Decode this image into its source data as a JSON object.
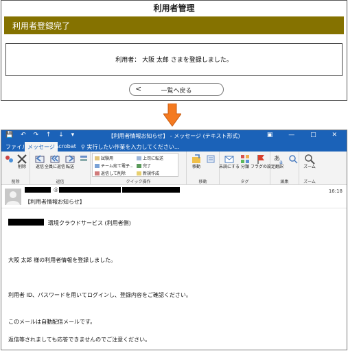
{
  "web": {
    "title": "利用者管理",
    "banner": "利用者登録完了",
    "message": "利用者： 大阪 太郎 さまを登録しました。",
    "back_chevron": "<",
    "back_label": "一覧へ戻る"
  },
  "outlook": {
    "window_title": "【利用者情報お知らせ】 - メッセージ (テキスト形式)",
    "tabs": [
      "ファイル",
      "メッセージ",
      "Acrobat"
    ],
    "tell_me": "実行したい作業を入力してください...",
    "groups": [
      "削除",
      "返信",
      "クイック操作",
      "移動",
      "タグ",
      "編集",
      "ズーム"
    ],
    "buttons": {
      "delete": "削除",
      "reply": "返信",
      "reply_all": "全員に返信",
      "forward": "転送",
      "move": "移動",
      "unread": "未読にする",
      "categorize": "分類",
      "followup": "フラグの設定",
      "translate": "翻訳",
      "zoom": "ズーム"
    },
    "quick_steps": [
      "試験用",
      "チーム宛て電子...",
      "返信して削除",
      "上司に転送",
      "完了",
      "新規作成"
    ],
    "sender_partial": "@",
    "subject": "【利用者情報お知らせ】",
    "time": "16:18",
    "body": [
      "環境クラウドサービス (利用者側)",
      "大阪 太郎 様の利用者情報を登録しました。",
      "利用者 ID、パスワードを用いてログインし、登録内容をご確認ください。",
      "このメールは自動配信メールです。",
      "返信等されましても応答できませんのでご注意ください。"
    ]
  },
  "colors": {
    "banner": "#857200",
    "outlook_blue": "#1b62b8",
    "arrow": "#f47a20"
  }
}
